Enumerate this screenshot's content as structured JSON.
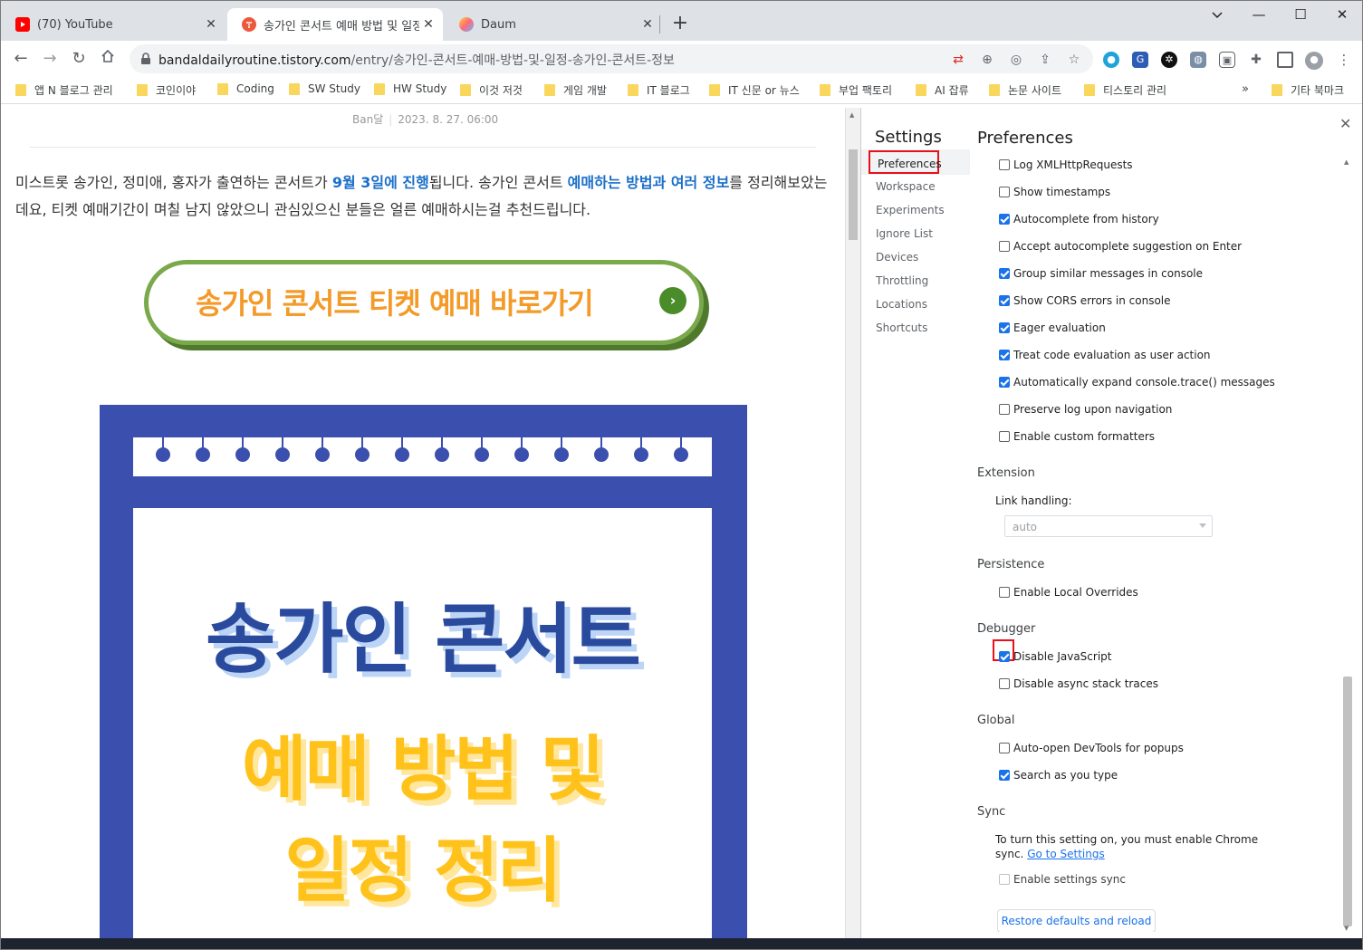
{
  "tabs": [
    {
      "title": "(70) YouTube",
      "icon": "youtube-icon"
    },
    {
      "title": "송가인 콘서트 예매 방법 및 일정",
      "icon": "tistory-icon"
    },
    {
      "title": "Daum",
      "icon": "daum-icon"
    }
  ],
  "address": {
    "host": "bandaldailyroutine.tistory.com",
    "path": "/entry/송가인-콘서트-예매-방법-및-일정-송가인-콘서트-정보"
  },
  "bookmarks": [
    "앱 N 블로그 관리",
    "코인이야",
    "Coding",
    "SW Study",
    "HW Study",
    "이것 저것",
    "게임 개발",
    "IT 블로그",
    "IT 신문 or 뉴스",
    "부업 팩토리",
    "AI 잡류",
    "논문 사이트",
    "티스토리 관리",
    "기타 북마크"
  ],
  "bookmarks_more": "»",
  "article": {
    "author": "Ban달",
    "date": "2023. 8. 27. 06:00",
    "p1": "미스트롯 송가인, 정미애, 홍자가 출연하는 콘서트가 ",
    "p1_hl": "9월 3일에 진행",
    "p2": "됩니다. 송가인 콘서트 ",
    "p2_hl": "예매하는 방법과 여러 정보",
    "p3": "를 정리해보았는데요, 티켓 예매기간이 며칠 남지 않았으니 관심있으신 분들은 얼른 예매하시는걸 추천드립니다.",
    "button_text": "송가인 콘서트 티켓 예매 바로가기",
    "poster_line1": "송가인 콘서트",
    "poster_line2": "예매 방법 및",
    "poster_line3": "일정 정리"
  },
  "devtools": {
    "settings_title": "Settings",
    "pane_title": "Preferences",
    "sidebar": [
      "Preferences",
      "Workspace",
      "Experiments",
      "Ignore List",
      "Devices",
      "Throttling",
      "Locations",
      "Shortcuts"
    ],
    "console_options": [
      {
        "label": "Log XMLHttpRequests",
        "checked": false
      },
      {
        "label": "Show timestamps",
        "checked": false
      },
      {
        "label": "Autocomplete from history",
        "checked": true
      },
      {
        "label": "Accept autocomplete suggestion on Enter",
        "checked": false
      },
      {
        "label": "Group similar messages in console",
        "checked": true
      },
      {
        "label": "Show CORS errors in console",
        "checked": true
      },
      {
        "label": "Eager evaluation",
        "checked": true
      },
      {
        "label": "Treat code evaluation as user action",
        "checked": true
      },
      {
        "label": "Automatically expand console.trace() messages",
        "checked": true
      },
      {
        "label": "Preserve log upon navigation",
        "checked": false
      },
      {
        "label": "Enable custom formatters",
        "checked": false
      }
    ],
    "extension": {
      "title": "Extension",
      "link_label": "Link handling:",
      "link_value": "auto"
    },
    "persistence": {
      "title": "Persistence",
      "option": "Enable Local Overrides"
    },
    "debugger": {
      "title": "Debugger",
      "opt1": "Disable JavaScript",
      "opt2": "Disable async stack traces"
    },
    "global": {
      "title": "Global",
      "opt1": "Auto-open DevTools for popups",
      "opt2": "Search as you type"
    },
    "sync": {
      "title": "Sync",
      "note": "To turn this setting on, you must enable Chrome sync. ",
      "link": "Go to Settings",
      "option": "Enable settings sync"
    },
    "restore_button": "Restore defaults and reload"
  }
}
